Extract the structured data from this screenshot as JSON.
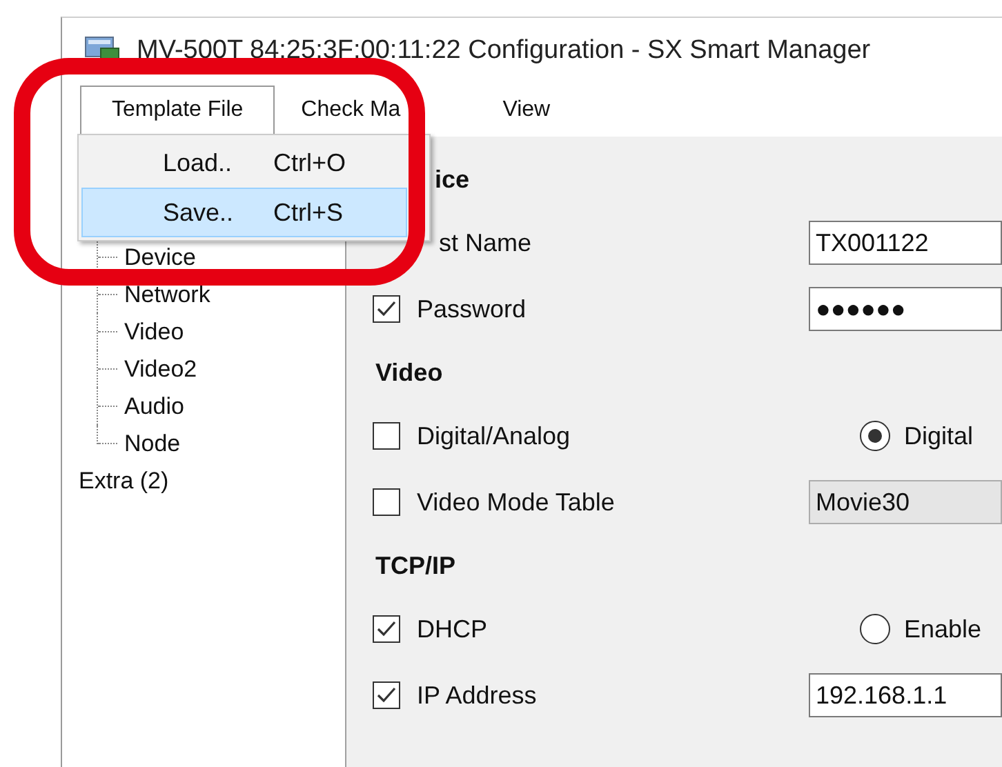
{
  "window": {
    "title": "MV-500T 84:25:3F:00:11:22  Configuration - SX Smart Manager"
  },
  "menu_bar": [
    {
      "label": "Template File",
      "selected": true
    },
    {
      "label": "Check Ma",
      "selected": false
    },
    {
      "label": "View",
      "selected": false
    }
  ],
  "dropdown": [
    {
      "label": "Load..",
      "shortcut": "Ctrl+O",
      "selected": false
    },
    {
      "label": "Save..",
      "shortcut": "Ctrl+S",
      "selected": true
    }
  ],
  "tree": [
    {
      "children": [
        {
          "label": "Device"
        },
        {
          "label": "Network"
        },
        {
          "label": "Video"
        },
        {
          "label": "Video2"
        },
        {
          "label": "Audio"
        },
        {
          "label": "Node"
        }
      ]
    },
    {
      "label": "Extra (2)"
    }
  ],
  "rows": [
    {
      "kind": "heading",
      "label": "ice"
    },
    {
      "kind": "check",
      "label": "st Name",
      "value": {
        "kind": "text",
        "text": "TX001122"
      }
    },
    {
      "kind": "check",
      "label": "Password",
      "checked": true,
      "value": {
        "kind": "text",
        "text": "●●●●●●"
      }
    },
    {
      "kind": "heading",
      "label": "Video"
    },
    {
      "kind": "check",
      "label": "Digital/Analog",
      "checked": false,
      "value": {
        "kind": "radio",
        "text": "Digital",
        "selected": true
      }
    },
    {
      "kind": "check",
      "label": "Video Mode Table",
      "checked": false,
      "value": {
        "kind": "select",
        "text": "Movie30"
      }
    },
    {
      "kind": "heading",
      "label": "TCP/IP"
    },
    {
      "kind": "check",
      "label": "DHCP",
      "checked": true,
      "value": {
        "kind": "radio",
        "text": "Enable",
        "selected": false
      }
    },
    {
      "kind": "check",
      "label": "IP Address",
      "checked": true,
      "value": {
        "kind": "text",
        "text": "192.168.1.1"
      }
    }
  ]
}
